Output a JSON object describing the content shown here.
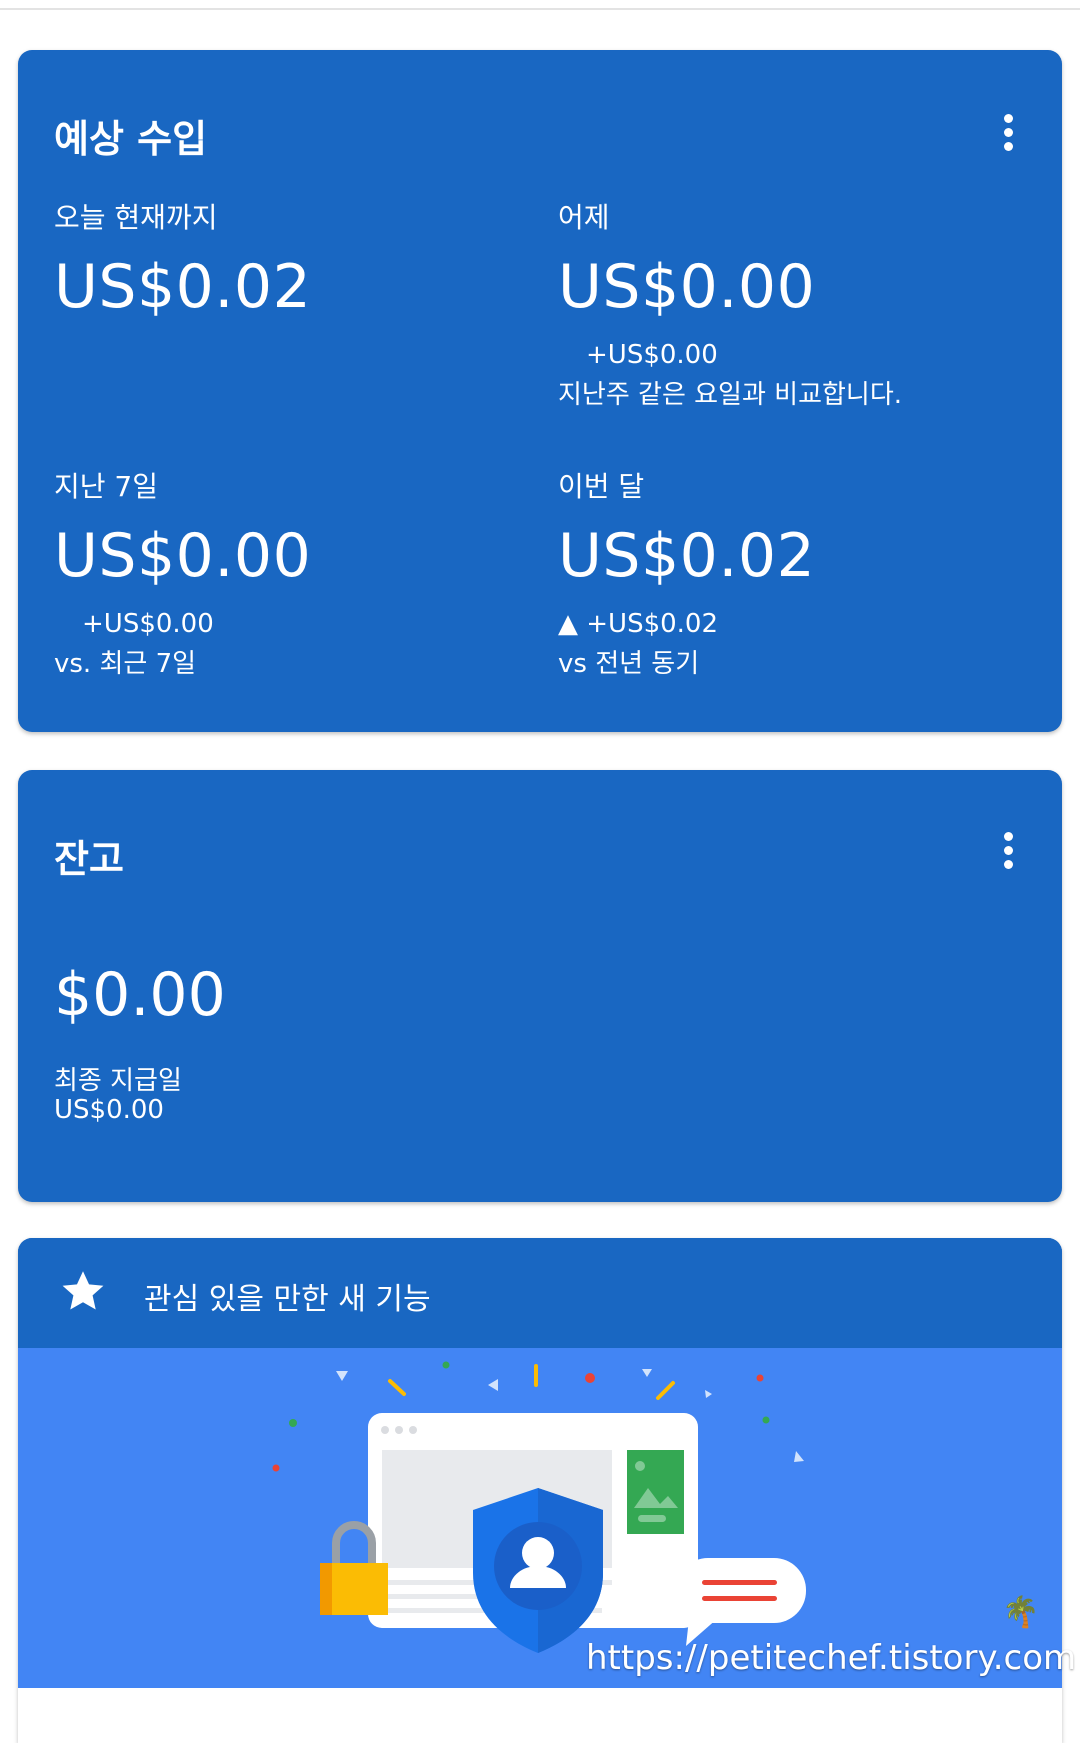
{
  "earnings": {
    "title": "예상 수입",
    "today": {
      "label": "오늘 현재까지",
      "value": "US$0.02"
    },
    "yesterday": {
      "label": "어제",
      "value": "US$0.00",
      "delta": "+US$0.00",
      "sub": "지난주 같은 요일과 비교합니다."
    },
    "last7": {
      "label": "지난 7일",
      "value": "US$0.00",
      "delta": "+US$0.00",
      "sub": "vs. 최근 7일"
    },
    "month": {
      "label": "이번 달",
      "value": "US$0.02",
      "delta": "▲ +US$0.02",
      "sub": "vs 전년 동기"
    }
  },
  "balance": {
    "title": "잔고",
    "value": "$0.00",
    "last_payment_label": "최종 지급일",
    "last_payment_value": "US$0.00"
  },
  "features": {
    "title": "관심 있을 만한 새 기능"
  },
  "watermark": "https://petitechef.tistory.com",
  "colors": {
    "card_bg": "#1967c2",
    "illustration_bg": "#4285f4",
    "text": "#ffffff",
    "shield": "#1a73e8",
    "lock": "#fbbc04",
    "image_tile": "#34a853",
    "message_lines": "#ea4335"
  }
}
